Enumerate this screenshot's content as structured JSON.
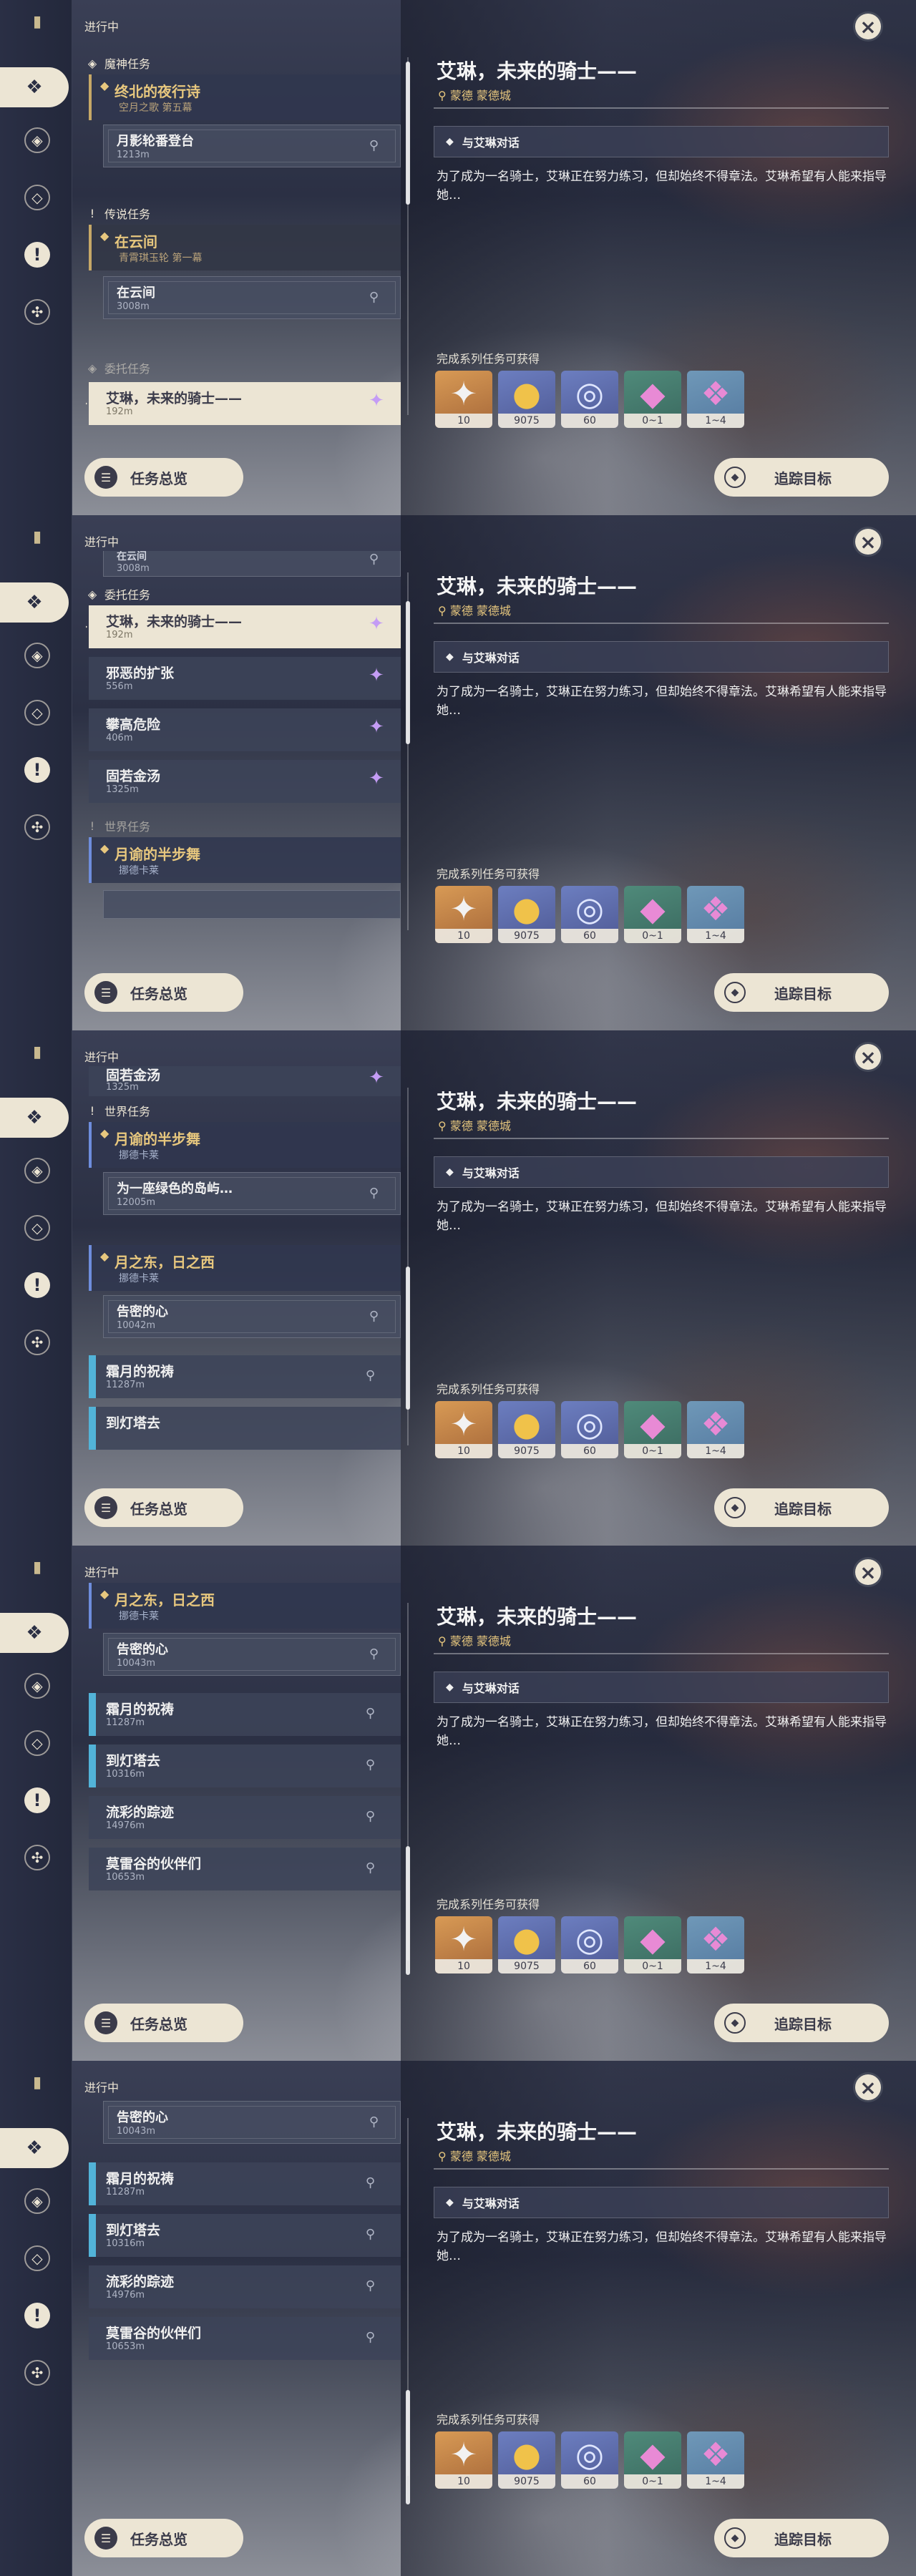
{
  "common": {
    "in_progress": "进行中",
    "summary_btn": "任务总览",
    "track_btn": "追踪目标",
    "close": "×",
    "detail_title": "艾琳，未来的骑士——",
    "detail_location": "蒙德 蒙德城",
    "objective": "与艾琳对话",
    "description": "为了成为一名骑士，艾琳正在努力练习，但却始终不得章法。艾琳希望有人能来指导她…",
    "rewards_label": "完成系列任务可获得",
    "rewards": [
      {
        "icon": "primogem-icon",
        "count": "10",
        "color": "#d89a55",
        "glyph": "✦"
      },
      {
        "icon": "mora-icon",
        "count": "9075",
        "color": "#6c7ec0",
        "glyph": "●"
      },
      {
        "icon": "exp-icon",
        "count": "60",
        "color": "#6c7ec0",
        "glyph": "◎"
      },
      {
        "icon": "crystal-icon",
        "count": "0~1",
        "color": "#4f8a7a",
        "glyph": "◆"
      },
      {
        "icon": "crystal-cluster-icon",
        "count": "1~4",
        "color": "#6f98b8",
        "glyph": "❖"
      }
    ]
  },
  "panels": [
    {
      "cat_archon": "魔神任务",
      "q1_title": "终北的夜行诗",
      "q1_sub": "空月之歌 第五幕",
      "q1_step_title": "月影轮番登台",
      "q1_step_dist": "1213m",
      "cat_legend": "传说任务",
      "q2_title": "在云间",
      "q2_sub": "青霄琪玉轮 第一幕",
      "q2_step_title": "在云间",
      "q2_step_dist": "3008m",
      "cat_commission": "委托任务",
      "q3_title": "艾琳，未来的骑士——",
      "q3_dist": "192m"
    },
    {
      "step_title": "在云间",
      "step_dist": "3008m",
      "cat_commission": "委托任务",
      "items": [
        {
          "title": "艾琳，未来的骑士——",
          "dist": "192m"
        },
        {
          "title": "邪恶的扩张",
          "dist": "556m"
        },
        {
          "title": "攀高危险",
          "dist": "406m"
        },
        {
          "title": "固若金汤",
          "dist": "1325m"
        }
      ],
      "cat_world": "世界任务",
      "world_title": "月谕的半步舞",
      "world_sub": "挪德卡莱"
    },
    {
      "item_title": "固若金汤",
      "item_dist": "1325m",
      "cat_world": "世界任务",
      "w1_title": "月谕的半步舞",
      "w1_sub": "挪德卡莱",
      "w1_step_title": "为一座绿色的岛屿…",
      "w1_step_dist": "12005m",
      "w2_title": "月之东，日之西",
      "w2_sub": "挪德卡莱",
      "w2_step_title": "告密的心",
      "w2_step_dist": "10042m",
      "i1_title": "霜月的祝祷",
      "i1_dist": "11287m",
      "i2_title": "到灯塔去"
    },
    {
      "w_title": "月之东，日之西",
      "w_sub": "挪德卡莱",
      "step_title": "告密的心",
      "step_dist": "10043m",
      "items": [
        {
          "title": "霜月的祝祷",
          "dist": "11287m"
        },
        {
          "title": "到灯塔去",
          "dist": "10316m"
        },
        {
          "title": "流彩的踪迹",
          "dist": "14976m"
        },
        {
          "title": "莫雷谷的伙伴们",
          "dist": "10653m"
        }
      ]
    },
    {
      "step_title": "告密的心",
      "step_dist": "10043m",
      "items": [
        {
          "title": "霜月的祝祷",
          "dist": "11287m"
        },
        {
          "title": "到灯塔去",
          "dist": "10316m"
        },
        {
          "title": "流彩的踪迹",
          "dist": "14976m"
        },
        {
          "title": "莫雷谷的伙伴们",
          "dist": "10653m"
        }
      ]
    }
  ]
}
